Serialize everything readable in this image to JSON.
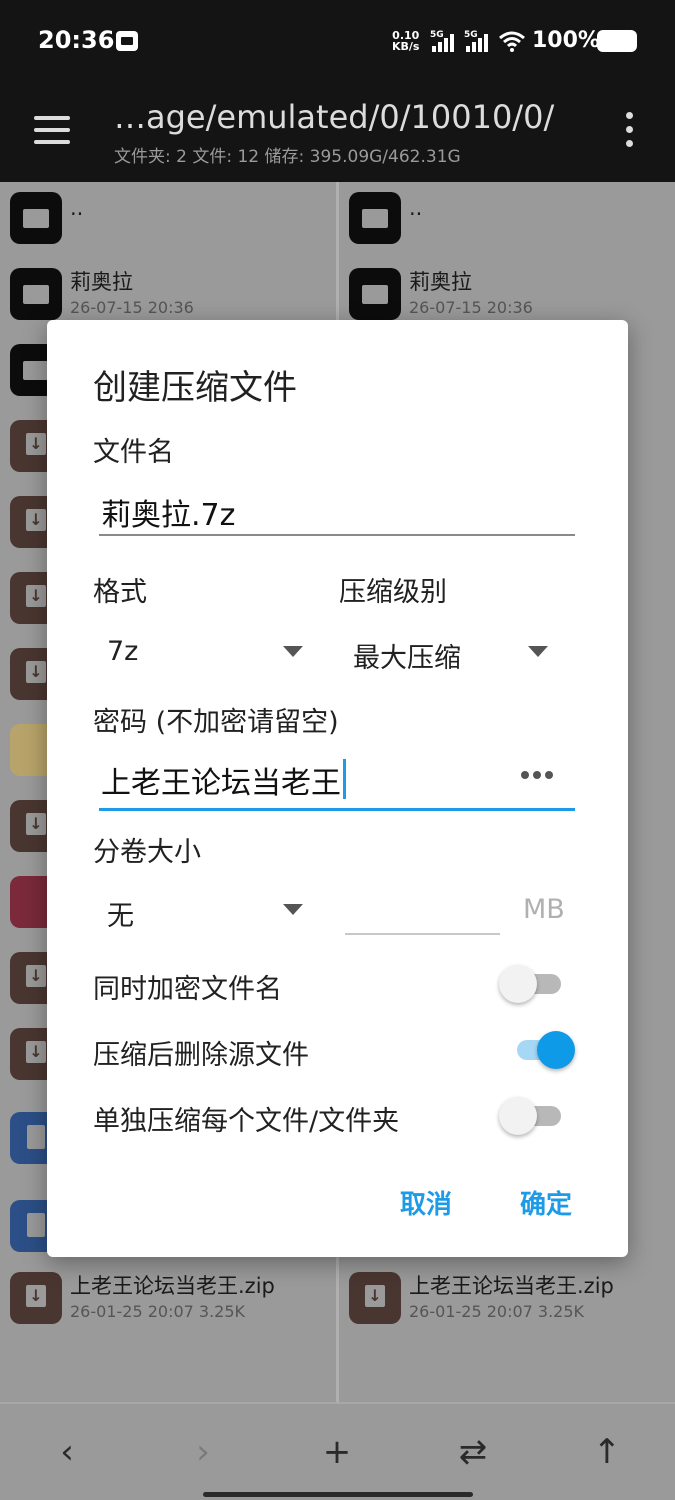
{
  "status_bar": {
    "time": "20:36",
    "net_speed_value": "0.10",
    "net_speed_unit": "KB/s",
    "signal_1_label": "5G",
    "signal_2_label": "5G",
    "battery": "100%"
  },
  "header": {
    "path": "…age/emulated/0/10010/0/",
    "stats": "文件夹: 2  文件: 12  储存: 395.09G/462.31G"
  },
  "left_panel": {
    "items": [
      {
        "name": "..",
        "meta": "",
        "icon": "folder"
      },
      {
        "name": "莉奥拉",
        "meta": "26-07-15 20:36",
        "icon": "folder"
      },
      {
        "name": "",
        "meta": "",
        "icon": "folder"
      },
      {
        "name": "",
        "meta": "",
        "icon": "archive"
      },
      {
        "name": "",
        "meta": "",
        "icon": "archive"
      },
      {
        "name": "",
        "meta": "",
        "icon": "archive"
      },
      {
        "name": "",
        "meta": "",
        "icon": "archive"
      },
      {
        "name": "",
        "meta": "",
        "icon": "image"
      },
      {
        "name": "",
        "meta": "",
        "icon": "archive"
      },
      {
        "name": "",
        "meta": "",
        "icon": "image"
      },
      {
        "name": "",
        "meta": "",
        "icon": "archive"
      },
      {
        "name": "",
        "meta": "",
        "icon": "archive"
      },
      {
        "name": "",
        "meta": "",
        "icon": "doc"
      },
      {
        "name": "",
        "meta": "",
        "icon": "doc"
      },
      {
        "name": "上老王论坛当老王.zip",
        "meta": "26-01-25 20:07  3.25K",
        "icon": "archive"
      }
    ]
  },
  "right_panel": {
    "items": [
      {
        "name": "..",
        "meta": "",
        "icon": "folder"
      },
      {
        "name": "莉奥拉",
        "meta": "26-07-15 20:36",
        "icon": "folder"
      },
      {
        "name": "上老王论坛当老王.zip",
        "meta": "26-01-25 20:07  3.25K",
        "icon": "archive"
      }
    ]
  },
  "dialog": {
    "title": "创建压缩文件",
    "filename_label": "文件名",
    "filename_value": "莉奥拉.7z",
    "format_label": "格式",
    "format_value": "7z",
    "level_label": "压缩级别",
    "level_value": "最大压缩",
    "password_label": "密码 (不加密请留空)",
    "password_value": "上老王论坛当老王",
    "volume_label": "分卷大小",
    "volume_value": "无",
    "volume_unit": "MB",
    "toggles": [
      {
        "label": "同时加密文件名",
        "on": false
      },
      {
        "label": "压缩后删除源文件",
        "on": true
      },
      {
        "label": "单独压缩每个文件/文件夹",
        "on": false
      }
    ],
    "cancel_label": "取消",
    "ok_label": "确定"
  },
  "bottom_bar": {
    "back_icon": "‹",
    "forward_icon": "›",
    "add_icon": "+",
    "swap_icon": "⇄",
    "up_icon": "↑"
  },
  "colors": {
    "accent": "#1e9be6",
    "toggle_on": "#0f9ae8",
    "header_bg": "#141414"
  }
}
